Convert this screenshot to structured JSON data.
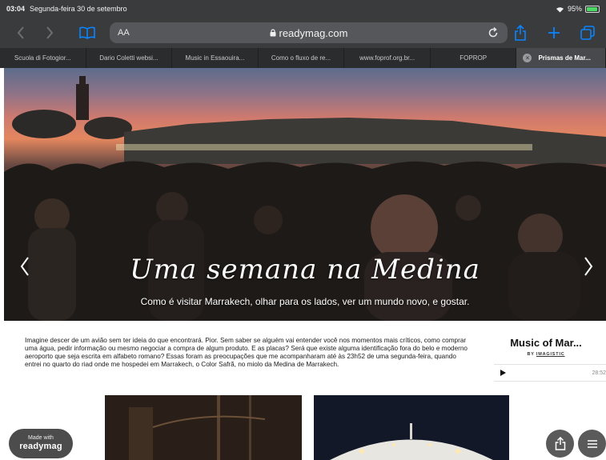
{
  "status": {
    "time": "03:04",
    "date": "Segunda-feira 30 de setembro",
    "battery": "95%",
    "battery_level": 0.95
  },
  "toolbar": {
    "text_size": "AA",
    "url": "readymag.com"
  },
  "tabs": [
    {
      "label": "Scuola di Fotogior..."
    },
    {
      "label": "Dario Coletti websi..."
    },
    {
      "label": "Music in Essaouira..."
    },
    {
      "label": "Como o fluxo de re..."
    },
    {
      "label": "www.foprof.org.br..."
    },
    {
      "label": "FOPROP"
    },
    {
      "label": "Prismas de Mar...",
      "active": true
    }
  ],
  "hero": {
    "title": "Uma semana na Medina",
    "subtitle": "Como é visitar Marrakech, olhar para os lados, ver um mundo novo, e gostar."
  },
  "article": {
    "text": "Imagine descer de um avião sem ter ideia do que encontrará. Pior. Sem saber se alguém vai entender você nos momentos mais críticos, como comprar uma água, pedir informação ou mesmo negociar a compra de algum produto. E as placas? Será que existe alguma identificação fora do belo e moderno aeroporto que seja escrita em alfabeto romano? Essas foram as preocupações que me acompanharam até às 23h52 de uma segunda-feira, quando entrei no quarto do riad onde me hospedei em Marrakech, o Color Safrã, no miolo da Medina de Marrakech."
  },
  "music": {
    "title": "Music of Mar...",
    "by_label": "BY",
    "author": "IMAGISTIC",
    "duration": "28:52"
  },
  "badge": {
    "line1": "Made with",
    "line2": "readymag"
  },
  "colors": {
    "chrome": "#3a3b3d",
    "tabbar": "#2b2c2e",
    "accent": "#0a84ff",
    "battery": "#4cd964"
  }
}
